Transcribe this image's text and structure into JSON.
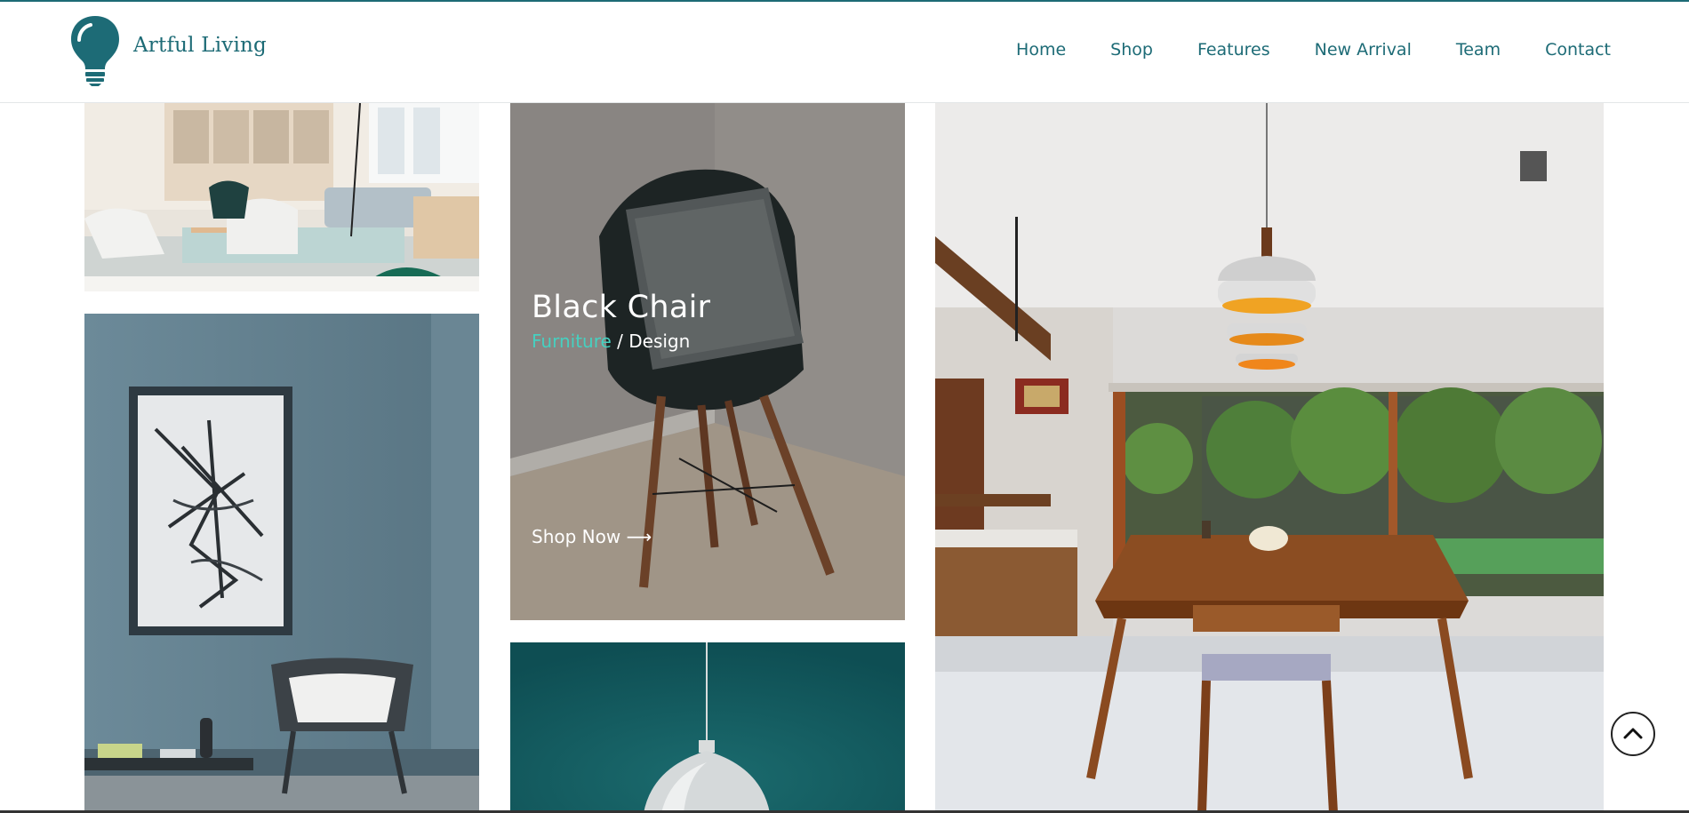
{
  "brand": {
    "name": "Artful Living",
    "logo_icon": "lightbulb-icon",
    "color": "#1d6b76"
  },
  "nav": {
    "items": [
      {
        "label": "Home"
      },
      {
        "label": "Shop"
      },
      {
        "label": "Features"
      },
      {
        "label": "New Arrival"
      },
      {
        "label": "Team"
      },
      {
        "label": "Contact"
      }
    ]
  },
  "featured": {
    "title": "Black Chair",
    "category": "Furniture",
    "separator": " / ",
    "subcategory": "Design",
    "cta": "Shop Now ⟶",
    "accent": "#46d0c0"
  },
  "gallery": {
    "images": [
      {
        "name": "living-room-photo"
      },
      {
        "name": "art-wall-photo"
      },
      {
        "name": "black-chair-photo"
      },
      {
        "name": "pendant-lamp-photo"
      },
      {
        "name": "dining-room-photo"
      }
    ]
  },
  "scroll_top": {
    "icon": "chevron-up-icon"
  }
}
